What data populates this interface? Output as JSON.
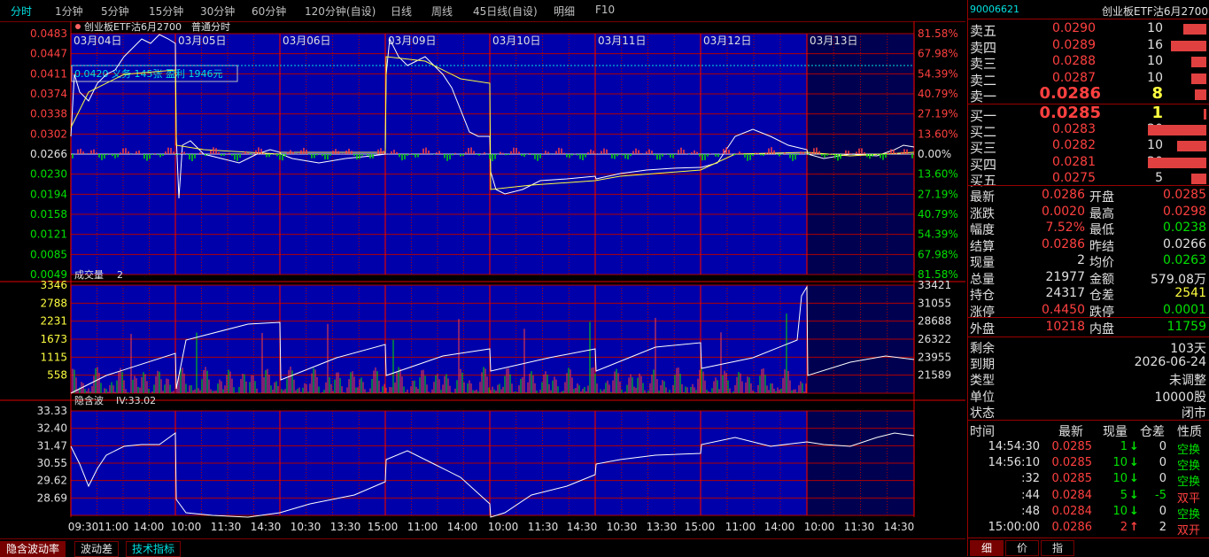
{
  "tabs": [
    "分时",
    "1分钟",
    "5分钟",
    "15分钟",
    "30分钟",
    "60分钟",
    "120分钟(自设)",
    "日线",
    "周线",
    "45日线(自设)",
    "明细",
    "F10"
  ],
  "main_chart": {
    "title": "创业板ETF沽6月2700",
    "mode": "普通分时",
    "info_box": "0.0420 义务 145张 盈利 1946元",
    "dates": [
      "03月04日",
      "03月05日",
      "03月06日",
      "03月09日",
      "03月10日",
      "03月11日",
      "03月12日",
      "03月13日"
    ],
    "y_left": [
      "0.0483",
      "0.0447",
      "0.0411",
      "0.0374",
      "0.0338",
      "0.0302",
      "0.0266",
      "0.0230",
      "0.0194",
      "0.0158",
      "0.0121",
      "0.0085",
      "0.0049"
    ],
    "y_right": [
      "81.58%",
      "67.98%",
      "54.39%",
      "40.79%",
      "27.19%",
      "13.60%",
      "0.00%",
      "13.60%",
      "27.19%",
      "40.79%",
      "54.39%",
      "67.98%",
      "81.58%"
    ]
  },
  "volume_chart": {
    "title": "成交量",
    "param": "2",
    "y_left": [
      "3346",
      "2788",
      "2231",
      "1673",
      "1115",
      "558"
    ],
    "y_right": [
      "33421",
      "31055",
      "28688",
      "26322",
      "23955",
      "21589"
    ]
  },
  "iv_chart": {
    "title": "隐含波",
    "iv_label": "IV:33.02",
    "y_left": [
      "33.33",
      "32.40",
      "31.47",
      "30.55",
      "29.62",
      "28.69"
    ]
  },
  "x_times": [
    "09:30",
    "11:00",
    "14:00",
    "10:00",
    "11:30",
    "14:30",
    "10:30",
    "13:30",
    "15:00",
    "11:00",
    "14:00",
    "10:00",
    "11:30",
    "14:30",
    "10:30",
    "13:30",
    "15:00",
    "11:00",
    "14:00",
    "10:00",
    "11:30",
    "14:30"
  ],
  "bottom_tabs": [
    "隐含波动率",
    "波动差",
    "技术指标"
  ],
  "panel": {
    "code": "90006621",
    "name": "创业板ETF沽6月2700",
    "asks": [
      {
        "label": "卖五",
        "price": "0.0290",
        "qty": "10",
        "bar": 0.4
      },
      {
        "label": "卖四",
        "price": "0.0289",
        "qty": "16",
        "bar": 0.6
      },
      {
        "label": "卖三",
        "price": "0.0288",
        "qty": "10",
        "bar": 0.25
      },
      {
        "label": "卖二",
        "price": "0.0287",
        "qty": "10",
        "bar": 0.25
      },
      {
        "label": "卖一",
        "price": "0.0286",
        "qty": "8",
        "bar": 0.2
      }
    ],
    "bids": [
      {
        "label": "买一",
        "price": "0.0285",
        "qty": "1",
        "bar": 0.05
      },
      {
        "label": "买二",
        "price": "0.0283",
        "qty": "20",
        "bar": 1.0
      },
      {
        "label": "买三",
        "price": "0.0282",
        "qty": "10",
        "bar": 0.5
      },
      {
        "label": "买四",
        "price": "0.0281",
        "qty": "20",
        "bar": 1.0
      },
      {
        "label": "买五",
        "price": "0.0275",
        "qty": "5",
        "bar": 0.25
      }
    ],
    "stats": [
      {
        "l1": "最新",
        "v1": "0.0286",
        "c1": "red",
        "l2": "开盘",
        "v2": "0.0285",
        "c2": "red"
      },
      {
        "l1": "涨跌",
        "v1": "0.0020",
        "c1": "red",
        "l2": "最高",
        "v2": "0.0298",
        "c2": "red"
      },
      {
        "l1": "幅度",
        "v1": "7.52%",
        "c1": "red",
        "l2": "最低",
        "v2": "0.0238",
        "c2": "green"
      },
      {
        "l1": "结算",
        "v1": "0.0286",
        "c1": "red",
        "l2": "昨结",
        "v2": "0.0266",
        "c2": "white"
      },
      {
        "l1": "现量",
        "v1": "2",
        "c1": "white",
        "l2": "均价",
        "v2": "0.0263",
        "c2": "green"
      },
      {
        "l1": "总量",
        "v1": "21977",
        "c1": "white",
        "l2": "金额",
        "v2": "579.08万",
        "c2": "white"
      },
      {
        "l1": "持仓",
        "v1": "24317",
        "c1": "white",
        "l2": "仓差",
        "v2": "2541",
        "c2": "yellow"
      },
      {
        "l1": "涨停",
        "v1": "0.4450",
        "c1": "red",
        "l2": "跌停",
        "v2": "0.0001",
        "c2": "green"
      }
    ],
    "outer": {
      "l1": "外盘",
      "v1": "10218",
      "l2": "内盘",
      "v2": "11759"
    },
    "info": [
      {
        "label": "剩余",
        "value": "103天"
      },
      {
        "label": "到期",
        "value": "2026-06-24"
      },
      {
        "label": "类型",
        "value": "未调整"
      },
      {
        "label": "单位",
        "value": "10000股"
      },
      {
        "label": "状态",
        "value": "闭市"
      }
    ],
    "trade_headers": [
      "时间",
      "最新",
      "现量",
      "仓差",
      "性质"
    ],
    "trades": [
      {
        "time": "14:54:30",
        "price": "0.0285",
        "vol": "1",
        "dir": "down",
        "diff": "0",
        "nature": "空换"
      },
      {
        "time": "14:56:10",
        "price": "0.0285",
        "vol": "10",
        "dir": "down",
        "diff": "0",
        "nature": "空换"
      },
      {
        "time": ":32",
        "price": "0.0285",
        "vol": "10",
        "dir": "down",
        "diff": "0",
        "nature": "空换"
      },
      {
        "time": ":44",
        "price": "0.0284",
        "vol": "5",
        "dir": "down",
        "diff": "-5",
        "nature": "双平"
      },
      {
        "time": ":48",
        "price": "0.0284",
        "vol": "10",
        "dir": "down",
        "diff": "0",
        "nature": "空换"
      },
      {
        "time": "15:00:00",
        "price": "0.0286",
        "vol": "2",
        "dir": "up",
        "diff": "2",
        "nature": "双开"
      }
    ],
    "panel_tabs": [
      "细",
      "价",
      "指"
    ]
  },
  "colors": {
    "up": "#ff4040",
    "down": "#00e000",
    "grid": "#b00000",
    "chart_bg": "#0000aa",
    "gray_bg": "#000050",
    "cyan": "#00e0e0"
  }
}
